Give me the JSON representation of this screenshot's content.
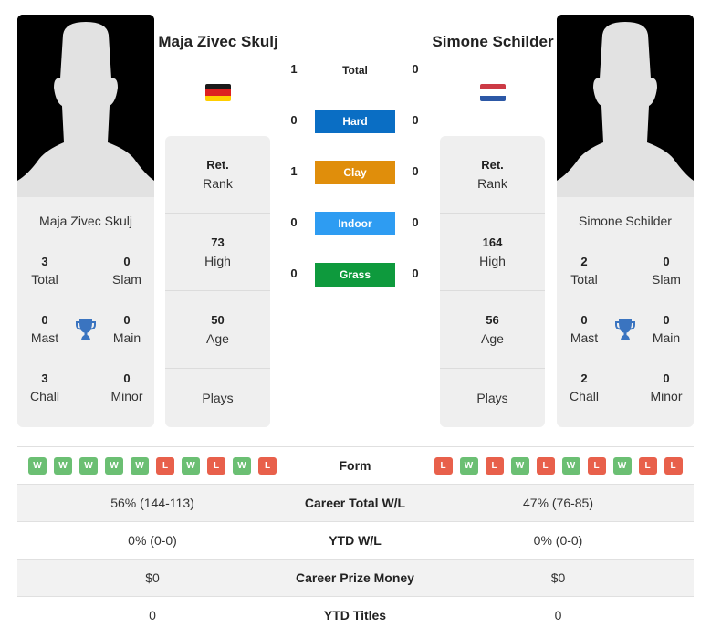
{
  "colors": {
    "hard": "#0a6ec4",
    "clay": "#e08e0b",
    "indoor": "#2e9cf2",
    "grass": "#0e9a3d",
    "win": "#6bbf73",
    "loss": "#e8604b",
    "trophy": "#3a74c0"
  },
  "player1": {
    "name": "Maja Zivec Skulj",
    "card_name": "Maja Zivec Skulj",
    "flag": "germany-flag",
    "flag_colors": [
      "#1a1a1a",
      "#dd2020",
      "#ffce00"
    ],
    "titles": {
      "total": {
        "value": "3",
        "label": "Total"
      },
      "slam": {
        "value": "0",
        "label": "Slam"
      },
      "mast": {
        "value": "0",
        "label": "Mast"
      },
      "main": {
        "value": "0",
        "label": "Main"
      },
      "chall": {
        "value": "3",
        "label": "Chall"
      },
      "minor": {
        "value": "0",
        "label": "Minor"
      }
    },
    "info": {
      "rank": {
        "value": "Ret.",
        "label": "Rank"
      },
      "high": {
        "value": "73",
        "label": "High"
      },
      "age": {
        "value": "50",
        "label": "Age"
      },
      "plays": {
        "value": "",
        "label": "Plays"
      }
    },
    "form": [
      "W",
      "W",
      "W",
      "W",
      "W",
      "L",
      "W",
      "L",
      "W",
      "L"
    ],
    "career_wl": "56% (144-113)",
    "ytd_wl": "0% (0-0)",
    "prize_money": "$0",
    "ytd_titles": "0"
  },
  "player2": {
    "name": "Simone Schilder",
    "card_name": "Simone Schilder",
    "flag": "netherlands-flag",
    "flag_colors": [
      "#cc3a45",
      "#ffffff",
      "#2c58a6"
    ],
    "titles": {
      "total": {
        "value": "2",
        "label": "Total"
      },
      "slam": {
        "value": "0",
        "label": "Slam"
      },
      "mast": {
        "value": "0",
        "label": "Mast"
      },
      "main": {
        "value": "0",
        "label": "Main"
      },
      "chall": {
        "value": "2",
        "label": "Chall"
      },
      "minor": {
        "value": "0",
        "label": "Minor"
      }
    },
    "info": {
      "rank": {
        "value": "Ret.",
        "label": "Rank"
      },
      "high": {
        "value": "164",
        "label": "High"
      },
      "age": {
        "value": "56",
        "label": "Age"
      },
      "plays": {
        "value": "",
        "label": "Plays"
      }
    },
    "form": [
      "L",
      "W",
      "L",
      "W",
      "L",
      "W",
      "L",
      "W",
      "L",
      "L"
    ],
    "career_wl": "47% (76-85)",
    "ytd_wl": "0% (0-0)",
    "prize_money": "$0",
    "ytd_titles": "0"
  },
  "h2h": {
    "total": {
      "label": "Total",
      "p1": "1",
      "p2": "0"
    },
    "surfaces": [
      {
        "key": "hard",
        "label": "Hard",
        "p1": "0",
        "p2": "0"
      },
      {
        "key": "clay",
        "label": "Clay",
        "p1": "1",
        "p2": "0"
      },
      {
        "key": "indoor",
        "label": "Indoor",
        "p1": "0",
        "p2": "0"
      },
      {
        "key": "grass",
        "label": "Grass",
        "p1": "0",
        "p2": "0"
      }
    ]
  },
  "table_labels": {
    "form": "Form",
    "career_wl": "Career Total W/L",
    "ytd_wl": "YTD W/L",
    "prize_money": "Career Prize Money",
    "ytd_titles": "YTD Titles"
  }
}
